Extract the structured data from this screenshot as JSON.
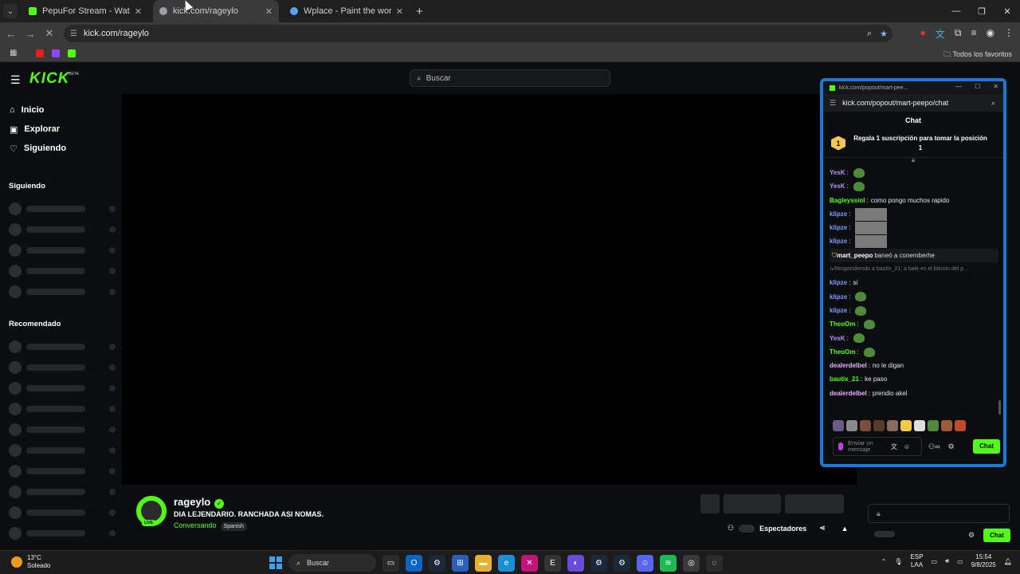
{
  "browser": {
    "tabs": [
      {
        "title": "PepuFor Stream - Watch Live o",
        "favicon_color": "#53fc18"
      },
      {
        "title": "kick.com/rageylo",
        "favicon_color": "#9aa0a6"
      },
      {
        "title": "Wplace - Paint the world",
        "favicon_color": "#5aa0ff"
      }
    ],
    "address": "kick.com/rageylo",
    "bookmarks_folder": "Todos los favoritos"
  },
  "kick": {
    "search_placeholder": "Buscar",
    "nav": [
      {
        "label": "Inicio",
        "icon": "home-icon"
      },
      {
        "label": "Explorar",
        "icon": "compass-icon"
      },
      {
        "label": "Siguiendo",
        "icon": "heart-icon"
      }
    ],
    "section_following": "Siguiendo",
    "section_recommended": "Recomendado",
    "stream": {
      "username": "rageylo",
      "title": "DIA LEJENDARIO. RANCHADA ASI NOMAS.",
      "category": "Conversando",
      "tag": "Spanish",
      "live_badge": "LIVE",
      "viewers_label": "Espectadores"
    },
    "right_chat": {
      "button": "Chat"
    }
  },
  "popout": {
    "window_title": "kick.com/popout/mart-pee...",
    "url": "kick.com/popout/mart-peepo/chat",
    "header": "Chat",
    "gift_rank": "1",
    "gift_text": "Regala 1 suscripción para tomar la posición 1",
    "messages": [
      {
        "user": "YesK",
        "color": "#c08aff",
        "text": "",
        "kind": "emote"
      },
      {
        "user": "YesK",
        "color": "#c08aff",
        "text": "",
        "kind": "emote"
      },
      {
        "user": "Bagleyssiol",
        "color": "#53fc18",
        "text": "como pongo muchos rapido",
        "kind": "text"
      },
      {
        "user": "klipze",
        "color": "#7b9cff",
        "text": "",
        "kind": "image"
      },
      {
        "user": "klipze",
        "color": "#7b9cff",
        "text": "",
        "kind": "image"
      },
      {
        "user": "klipze",
        "color": "#7b9cff",
        "text": "",
        "kind": "image"
      },
      {
        "user": "mart_peepo",
        "color": "#ffffff",
        "text": "baneó a conemberhe",
        "kind": "system"
      },
      {
        "user": "",
        "color": "#777777",
        "text": "Respondiendo a bautix_21: a bale es el bitcoin del p...",
        "kind": "reply"
      },
      {
        "user": "klipze",
        "color": "#7b9cff",
        "text": "si",
        "kind": "text"
      },
      {
        "user": "klipze",
        "color": "#7b9cff",
        "text": "",
        "kind": "emote"
      },
      {
        "user": "klipze",
        "color": "#7b9cff",
        "text": "",
        "kind": "emote"
      },
      {
        "user": "TheoOm",
        "color": "#53fc18",
        "text": "",
        "kind": "emote"
      },
      {
        "user": "YesK",
        "color": "#c08aff",
        "text": "",
        "kind": "emote"
      },
      {
        "user": "TheoOm",
        "color": "#53fc18",
        "text": "",
        "kind": "emote"
      },
      {
        "user": "dealerdelbel",
        "color": "#e8b0ff",
        "text": "no le digan",
        "kind": "text"
      },
      {
        "user": "bautix_21",
        "color": "#53fc18",
        "text": "ke paso",
        "kind": "text"
      },
      {
        "user": "dealerdelbel",
        "color": "#e8b0ff",
        "text": "prendio akel",
        "kind": "text"
      }
    ],
    "input_placeholder": "Enviar un mensaje",
    "chat_button": "Chat"
  },
  "taskbar": {
    "weather_temp": "13°C",
    "weather_desc": "Soleado",
    "search": "Buscar",
    "lang_line1": "ESP",
    "lang_line2": "LAA",
    "time": "15:54",
    "date": "9/8/2025"
  }
}
